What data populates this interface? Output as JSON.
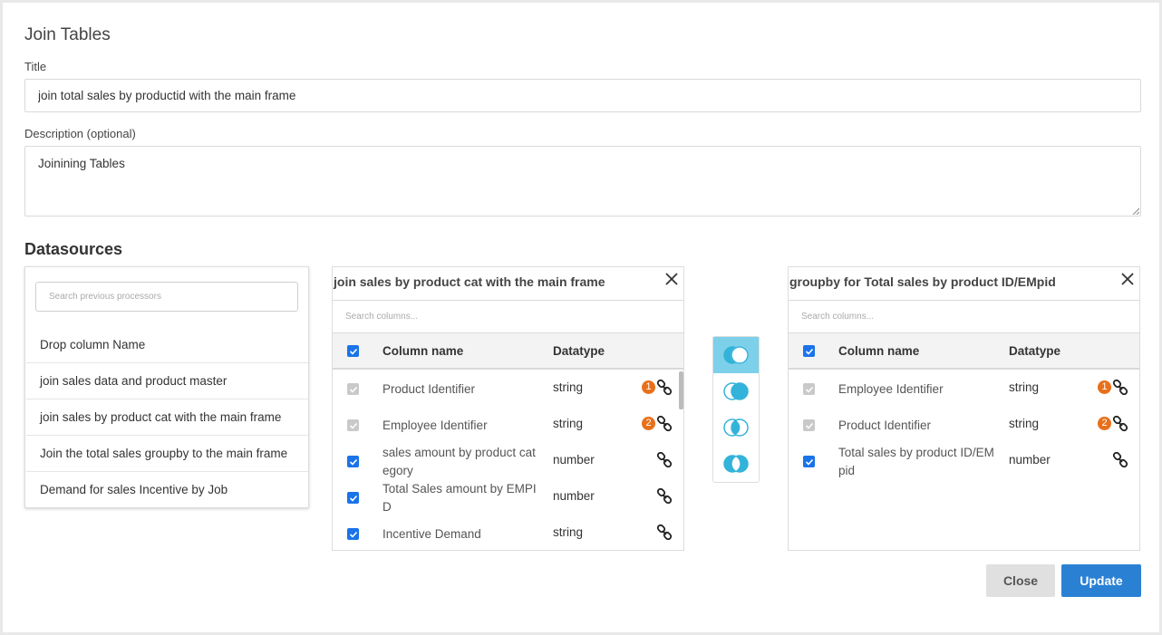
{
  "dialog": {
    "heading": "Join Tables",
    "title_label": "Title",
    "title_value": "join total sales by productid with the main frame",
    "description_label": "Description (optional)",
    "description_value": "Joinining Tables"
  },
  "datasources": {
    "heading": "Datasources",
    "search_placeholder": "Search previous processors",
    "items": [
      "Drop column Name",
      "join sales data and product master",
      "join sales by product cat with the main frame",
      "Join the total sales groupby to the main frame",
      "Demand for sales Incentive by Job"
    ]
  },
  "left_table": {
    "title": "join sales by product cat with the main frame",
    "search_placeholder": "Search columns...",
    "header_name": "Column name",
    "header_type": "Datatype",
    "rows": [
      {
        "name": [
          "Product Identifier"
        ],
        "type": "string",
        "checked": "disabled",
        "badge": "1"
      },
      {
        "name": [
          "Employee Identifier"
        ],
        "type": "string",
        "checked": "disabled",
        "badge": "2"
      },
      {
        "name": [
          "sales amount by product cat",
          "egory"
        ],
        "type": "number",
        "checked": "on",
        "badge": ""
      },
      {
        "name": [
          "Total Sales amount by EMPI",
          "D"
        ],
        "type": "number",
        "checked": "on",
        "badge": ""
      },
      {
        "name": [
          "Incentive Demand"
        ],
        "type": "string",
        "checked": "on",
        "badge": ""
      }
    ]
  },
  "right_table": {
    "title": "groupby for Total sales by product ID/EMpid",
    "search_placeholder": "Search columns...",
    "header_name": "Column name",
    "header_type": "Datatype",
    "rows": [
      {
        "name": [
          "Employee Identifier"
        ],
        "type": "string",
        "checked": "disabled",
        "badge": "1"
      },
      {
        "name": [
          "Product Identifier"
        ],
        "type": "string",
        "checked": "disabled",
        "badge": "2"
      },
      {
        "name": [
          "Total sales by product ID/EM",
          "pid"
        ],
        "type": "number",
        "checked": "on",
        "badge": ""
      }
    ]
  },
  "join_types": {
    "options": [
      "left-join-icon",
      "right-join-icon",
      "inner-join-icon",
      "outer-join-icon"
    ],
    "active": 0,
    "active_color": "#7dd0ea",
    "icon_color": "#33b3d9"
  },
  "buttons": {
    "close": "Close",
    "update": "Update"
  },
  "colors": {
    "primary": "#2a81d4",
    "checkbox": "#1a73e8",
    "badge": "#e8701a"
  }
}
